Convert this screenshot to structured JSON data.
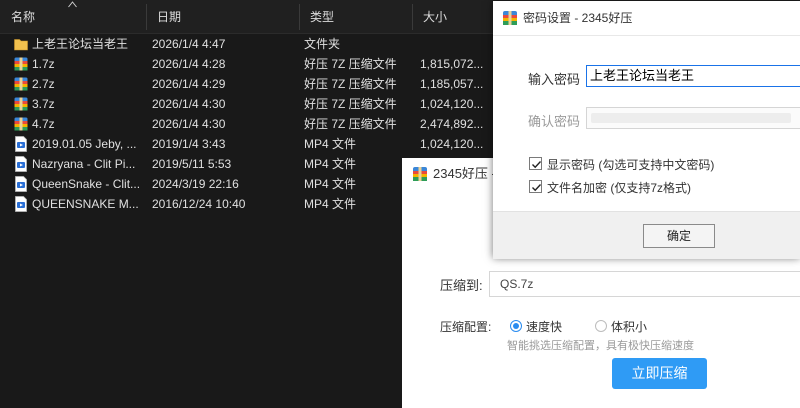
{
  "explorer": {
    "columns": {
      "name": "名称",
      "date": "日期",
      "type": "类型",
      "size": "大小"
    },
    "files": [
      {
        "icon": "folder-icon",
        "name": "上老王论坛当老王",
        "date": "2026/1/4 4:47",
        "type": "文件夹",
        "size": ""
      },
      {
        "icon": "archive-icon",
        "name": "1.7z",
        "date": "2026/1/4 4:28",
        "type": "好压 7Z 压缩文件",
        "size": "1,815,072..."
      },
      {
        "icon": "archive-icon",
        "name": "2.7z",
        "date": "2026/1/4 4:29",
        "type": "好压 7Z 压缩文件",
        "size": "1,185,057..."
      },
      {
        "icon": "archive-icon",
        "name": "3.7z",
        "date": "2026/1/4 4:30",
        "type": "好压 7Z 压缩文件",
        "size": "1,024,120..."
      },
      {
        "icon": "archive-icon",
        "name": "4.7z",
        "date": "2026/1/4 4:30",
        "type": "好压 7Z 压缩文件",
        "size": "2,474,892..."
      },
      {
        "icon": "video-file-icon",
        "name": "2019.01.05 Jeby, ...",
        "date": "2019/1/4 3:43",
        "type": "MP4 文件",
        "size": "1,024,120..."
      },
      {
        "icon": "video-file-icon",
        "name": "Nazryana - Clit Pi...",
        "date": "2019/5/11 5:53",
        "type": "MP4 文件",
        "size": ""
      },
      {
        "icon": "video-file-icon",
        "name": "QueenSnake - Clit...",
        "date": "2024/3/19 22:16",
        "type": "MP4 文件",
        "size": ""
      },
      {
        "icon": "video-file-icon",
        "name": "QUEENSNAKE M...",
        "date": "2016/12/24 10:40",
        "type": "MP4 文件",
        "size": ""
      }
    ]
  },
  "password_dialog": {
    "title": "密码设置 - 2345好压",
    "password_label": "输入密码",
    "password_value": "上老王论坛当老王",
    "confirm_label": "确认密码",
    "show_password": {
      "label": "显示密码 (勾选可支持中文密码)",
      "checked": true
    },
    "encrypt_names": {
      "label": "文件名加密 (仅支持7z格式)",
      "checked": true
    },
    "ok_label": "确定"
  },
  "compress_dialog": {
    "title": "2345好压 -",
    "path_label": "压缩到:",
    "path_value": "QS.7z",
    "config_label": "压缩配置:",
    "options": [
      {
        "label": "速度快",
        "selected": true
      },
      {
        "label": "体积小",
        "selected": false
      }
    ],
    "hint": "智能挑选压缩配置，具有极快压缩速度",
    "start_label": "立即压缩"
  },
  "colors": {
    "explorer_bg": "#191919",
    "accent_blue": "#2f9bf5",
    "folder_yellow": "#f2c14e"
  }
}
